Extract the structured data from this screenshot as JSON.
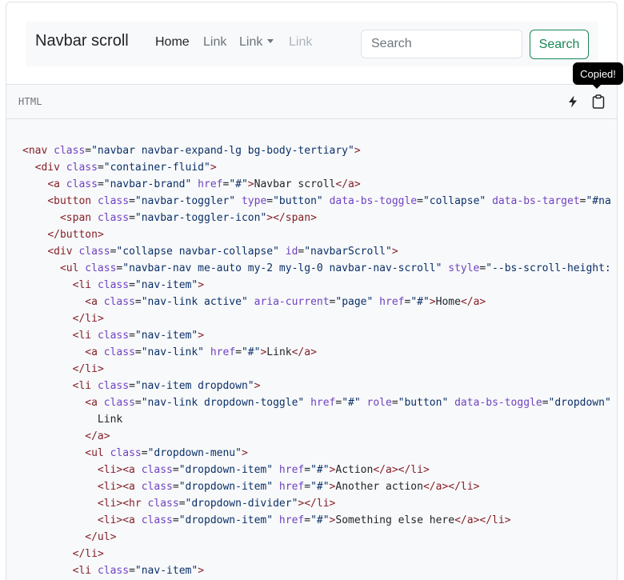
{
  "navbar": {
    "brand": "Navbar scroll",
    "links": [
      {
        "label": "Home",
        "state": "active"
      },
      {
        "label": "Link",
        "state": "normal"
      },
      {
        "label": "Link",
        "state": "dropdown"
      },
      {
        "label": "Link",
        "state": "disabled"
      }
    ],
    "search_placeholder": "Search",
    "search_button": "Search"
  },
  "toolbar": {
    "language": "HTML",
    "tooltip": "Copied!",
    "icons": [
      "lightning-icon",
      "clipboard-icon"
    ]
  },
  "colors": {
    "tag": "#842029",
    "attribute": "#6f42c1",
    "string": "#0a3069",
    "success": "#198754"
  },
  "code_lines": [
    "<nav class=\"navbar navbar-expand-lg bg-body-tertiary\">",
    "  <div class=\"container-fluid\">",
    "    <a class=\"navbar-brand\" href=\"#\">Navbar scroll</a>",
    "    <button class=\"navbar-toggler\" type=\"button\" data-bs-toggle=\"collapse\" data-bs-target=\"#na",
    "      <span class=\"navbar-toggler-icon\"></span>",
    "    </button>",
    "    <div class=\"collapse navbar-collapse\" id=\"navbarScroll\">",
    "      <ul class=\"navbar-nav me-auto my-2 my-lg-0 navbar-nav-scroll\" style=\"--bs-scroll-height:",
    "        <li class=\"nav-item\">",
    "          <a class=\"nav-link active\" aria-current=\"page\" href=\"#\">Home</a>",
    "        </li>",
    "        <li class=\"nav-item\">",
    "          <a class=\"nav-link\" href=\"#\">Link</a>",
    "        </li>",
    "        <li class=\"nav-item dropdown\">",
    "          <a class=\"nav-link dropdown-toggle\" href=\"#\" role=\"button\" data-bs-toggle=\"dropdown\"",
    "            Link",
    "          </a>",
    "          <ul class=\"dropdown-menu\">",
    "            <li><a class=\"dropdown-item\" href=\"#\">Action</a></li>",
    "            <li><a class=\"dropdown-item\" href=\"#\">Another action</a></li>",
    "            <li><hr class=\"dropdown-divider\"></li>",
    "            <li><a class=\"dropdown-item\" href=\"#\">Something else here</a></li>",
    "          </ul>",
    "        </li>",
    "        <li class=\"nav-item\">"
  ]
}
